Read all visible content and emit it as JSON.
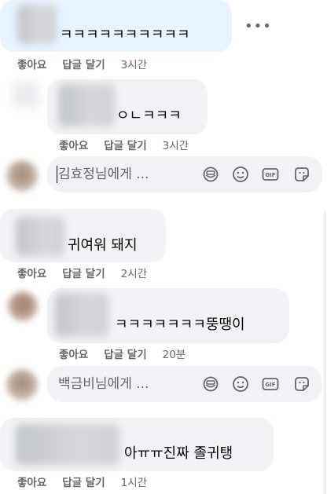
{
  "actions": {
    "like": "좋아요",
    "reply": "답글 달기"
  },
  "more_menu": "•••",
  "comments": [
    {
      "text": "ㅋㅋㅋㅋㅋㅋㅋㅋㅋㅋ",
      "time": "3시간"
    },
    {
      "text": "ㅇㄴㅋㅋㅋ",
      "time": "3시간"
    },
    {
      "text": "귀여워 돼지",
      "time": "2시간"
    },
    {
      "text": "ㅋㅋㅋㅋㅋㅋㅋ뚱땡이",
      "time": "20분"
    },
    {
      "text": "아ㅠㅠ진짜 졸귀탱",
      "time": "1시간"
    }
  ],
  "reply_boxes": [
    {
      "placeholder": "김효정님에게 ..."
    },
    {
      "placeholder": "백금비님에게 ..."
    }
  ],
  "reply_icons": [
    "sticker-icon",
    "emoji-icon",
    "gif-icon",
    "avatar-sticker-icon"
  ],
  "colors": {
    "bubble": "#f0f2f5",
    "bubble_highlight": "#e7f3ff",
    "secondary_text": "#65676b"
  }
}
